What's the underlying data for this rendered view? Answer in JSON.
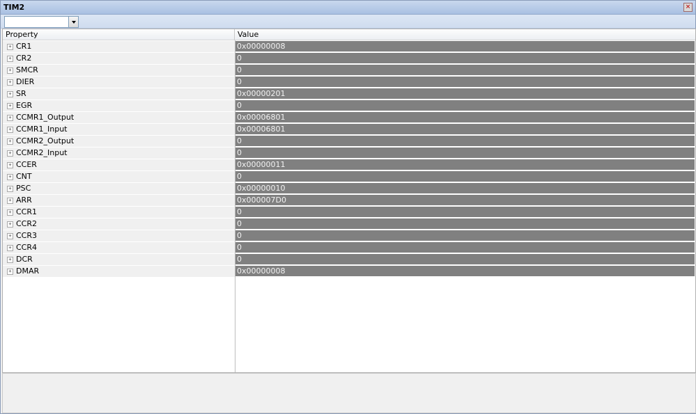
{
  "window": {
    "title": "TIM2"
  },
  "toolbar": {
    "selector_value": ""
  },
  "grid": {
    "headers": {
      "property": "Property",
      "value": "Value"
    },
    "rows": [
      {
        "name": "CR1",
        "value": "0x00000008"
      },
      {
        "name": "CR2",
        "value": "0"
      },
      {
        "name": "SMCR",
        "value": "0"
      },
      {
        "name": "DIER",
        "value": "0"
      },
      {
        "name": "SR",
        "value": "0x00000201"
      },
      {
        "name": "EGR",
        "value": "0"
      },
      {
        "name": "CCMR1_Output",
        "value": "0x00006801"
      },
      {
        "name": "CCMR1_Input",
        "value": "0x00006801"
      },
      {
        "name": "CCMR2_Output",
        "value": "0"
      },
      {
        "name": "CCMR2_Input",
        "value": "0"
      },
      {
        "name": "CCER",
        "value": "0x00000011"
      },
      {
        "name": "CNT",
        "value": "0"
      },
      {
        "name": "PSC",
        "value": "0x00000010"
      },
      {
        "name": "ARR",
        "value": "0x000007D0"
      },
      {
        "name": "CCR1",
        "value": "0"
      },
      {
        "name": "CCR2",
        "value": "0"
      },
      {
        "name": "CCR3",
        "value": "0"
      },
      {
        "name": "CCR4",
        "value": "0"
      },
      {
        "name": "DCR",
        "value": "0"
      },
      {
        "name": "DMAR",
        "value": "0x00000008"
      }
    ]
  },
  "icons": {
    "expander": "plus-expander-icon",
    "close": "close-icon",
    "dropdown": "chevron-down-icon"
  },
  "colors": {
    "value_cell_bg": "#808080",
    "title_bar": "#b5c9e8"
  }
}
